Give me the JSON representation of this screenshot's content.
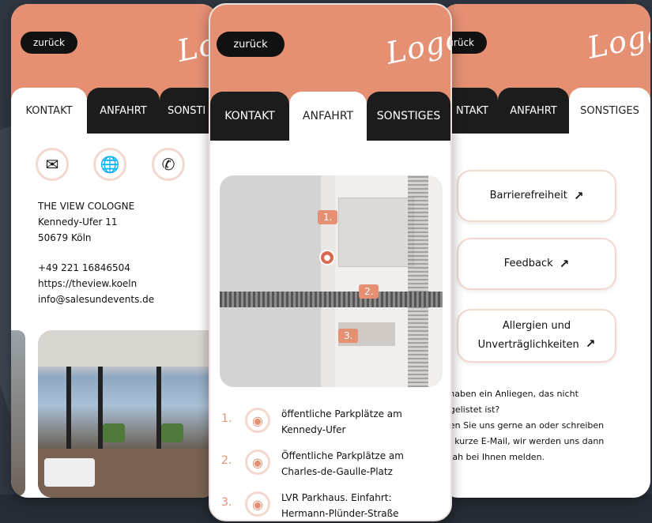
{
  "common": {
    "back_label": "zurück",
    "logo_text": "Logo",
    "tabs": [
      "KONTAKT",
      "ANFAHRT",
      "SONSTIGES"
    ],
    "left_tab_truncated": "SONSTI",
    "right_tab_truncated": "NTAKT"
  },
  "kontakt": {
    "icons": [
      "mail-icon",
      "globe-icon",
      "phone-icon"
    ],
    "address": [
      "THE VIEW COLOGNE",
      "Kennedy-Ufer 11",
      "50679 Köln"
    ],
    "phone": "+49 221 16846504",
    "website": "https://theview.koeln",
    "email": "info@salesundevents.de"
  },
  "anfahrt": {
    "map_markers": [
      "1.",
      "2.",
      "3."
    ],
    "items": [
      {
        "num": "1.",
        "line1": "öffentliche Parkplätze am",
        "line2": "Kennedy-Ufer"
      },
      {
        "num": "2.",
        "line1": "Öffentliche Parkplätze am",
        "line2": "Charles-de-Gaulle-Platz"
      },
      {
        "num": "3.",
        "line1": "LVR Parkhaus. Einfahrt:",
        "line2": "Hermann-Plünder-Straße"
      }
    ]
  },
  "sonstiges": {
    "buttons": [
      {
        "label": "Barrierefreiheit"
      },
      {
        "label": "Feedback"
      },
      {
        "label_line1": "Allergien und",
        "label_line2": "Unverträglichkeiten"
      }
    ],
    "help_lines": [
      "e haben ein Anliegen, das nicht",
      "ufgelistet ist?",
      "ufen Sie uns gerne an oder schreiben",
      "ne kurze E-Mail, wir werden uns dann",
      "itnah bei Ihnen melden."
    ]
  },
  "colors": {
    "brand": "#e58f73",
    "dark": "#1c1c1c",
    "background": "#2f3742"
  }
}
